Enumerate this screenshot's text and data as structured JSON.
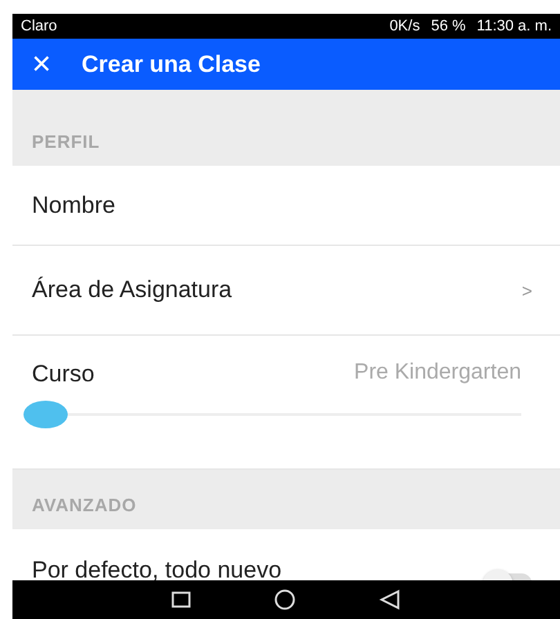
{
  "status_bar": {
    "carrier": "Claro",
    "speed": "0K/s",
    "battery": "56 %",
    "time": "11:30 a. m."
  },
  "app_bar": {
    "close": "×",
    "title": "Crear una Clase"
  },
  "sections": [
    {
      "header": "PERFIL",
      "rows": [
        {
          "kind": "text",
          "label": "Nombre"
        },
        {
          "kind": "link",
          "label": "Área de Asignatura",
          "chevron": ">"
        },
        {
          "kind": "slider",
          "label": "Curso",
          "value": "Pre Kindergarten",
          "level": 0
        }
      ]
    },
    {
      "header": "AVANZADO",
      "rows": [
        {
          "kind": "toggle",
          "label": "Por defecto, todo nuevo",
          "on": false
        }
      ]
    }
  ]
}
